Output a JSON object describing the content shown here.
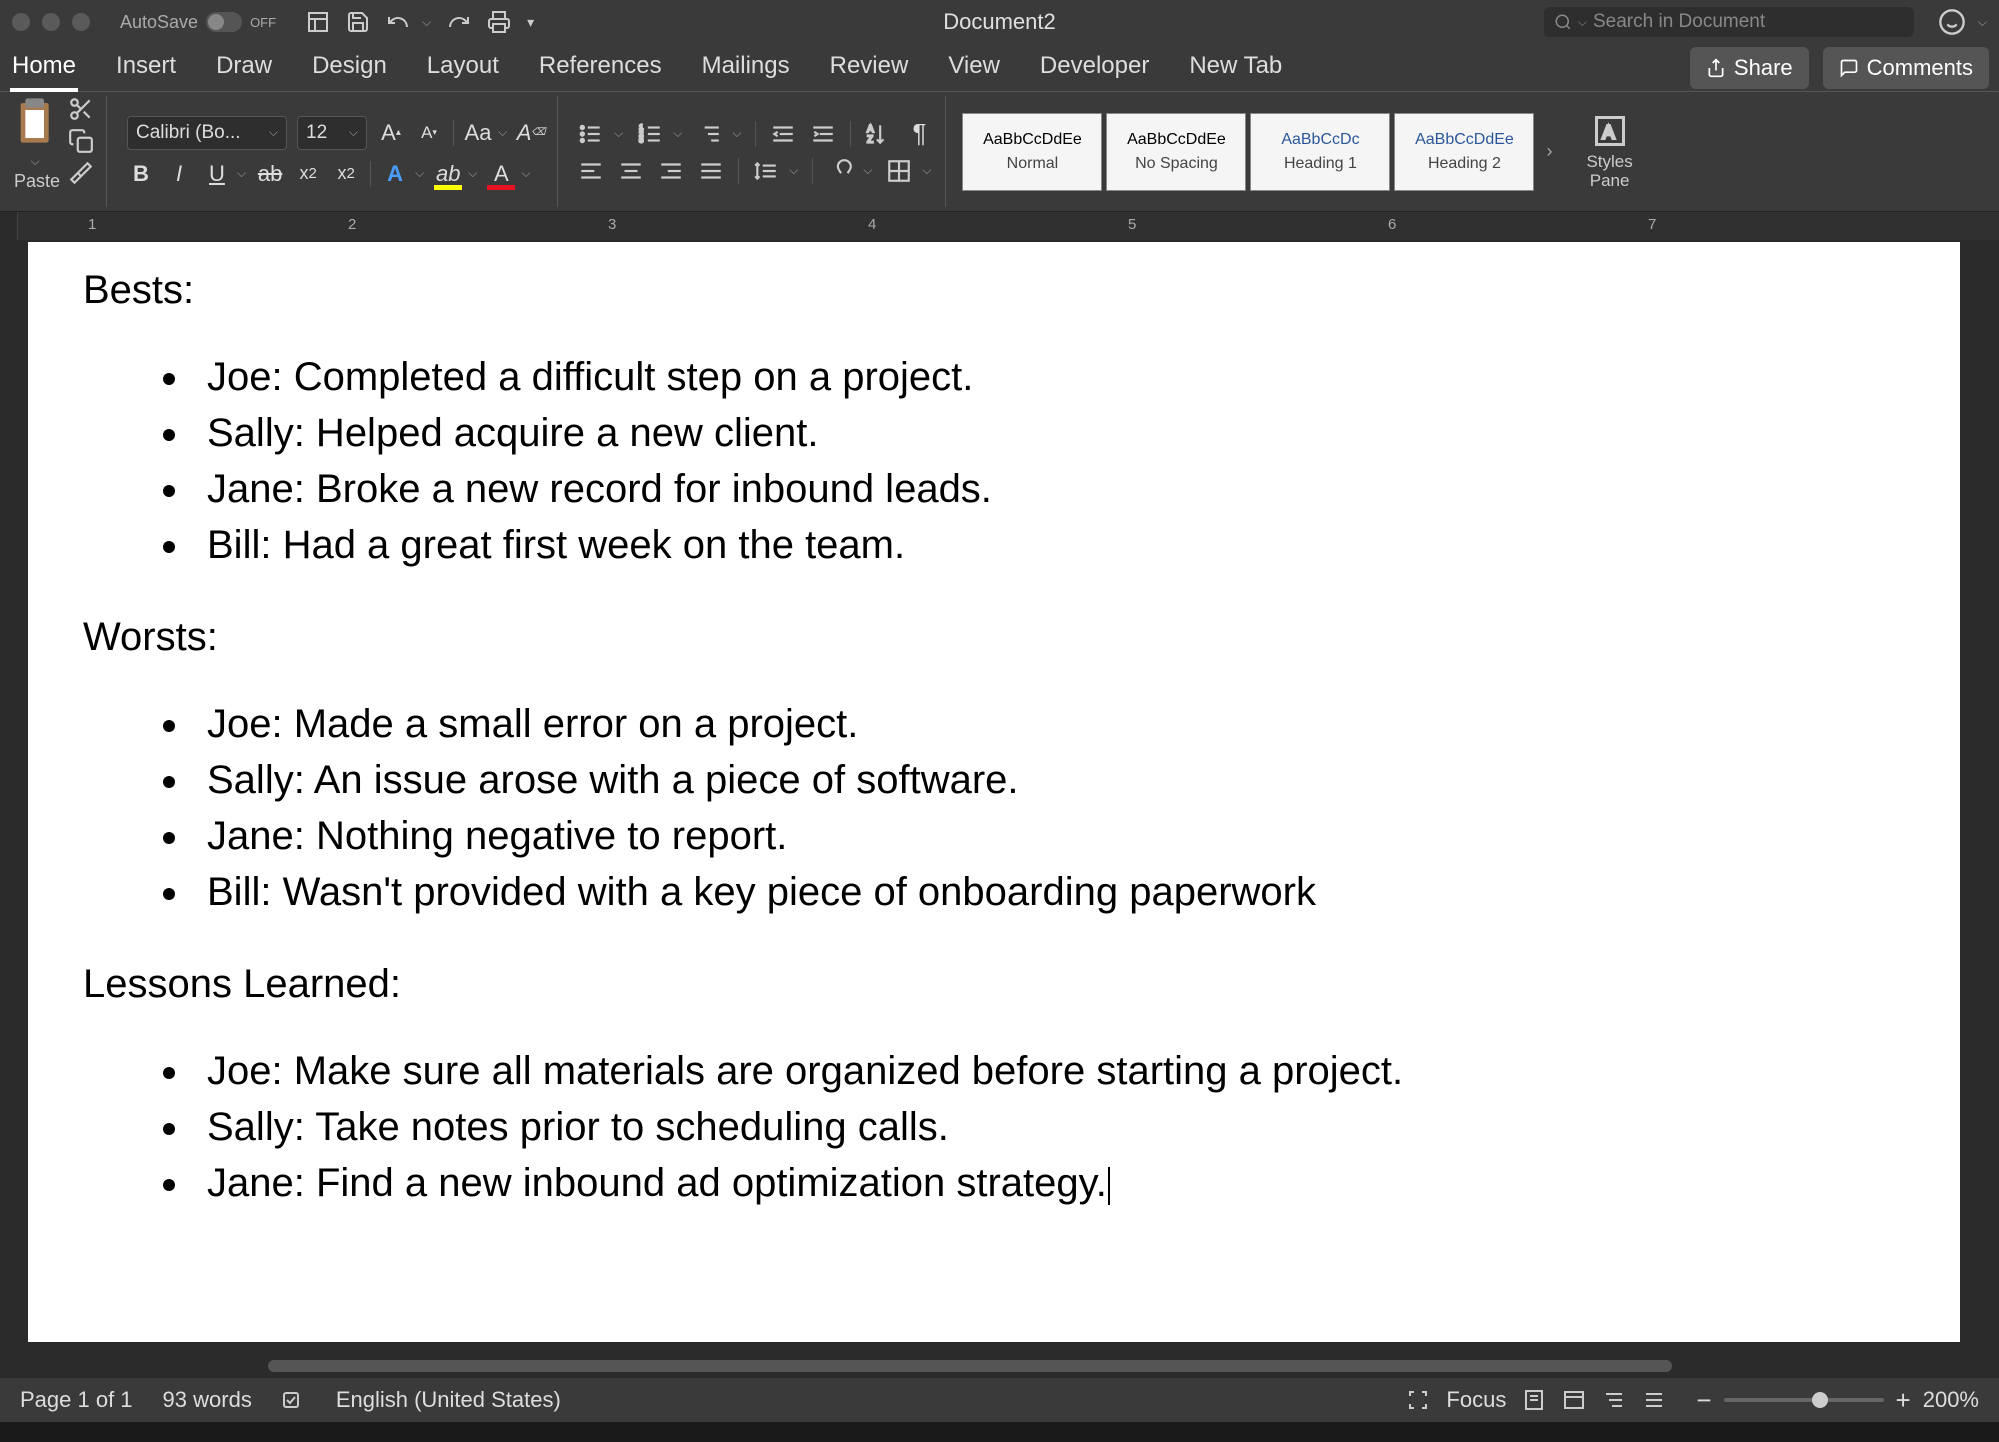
{
  "titlebar": {
    "autosave_label": "AutoSave",
    "autosave_state": "OFF",
    "doc_title": "Document2",
    "search_placeholder": "Search in Document"
  },
  "tabs": {
    "items": [
      "Home",
      "Insert",
      "Draw",
      "Design",
      "Layout",
      "References",
      "Mailings",
      "Review",
      "View",
      "Developer",
      "New Tab"
    ],
    "active_index": 0,
    "share": "Share",
    "comments": "Comments"
  },
  "ribbon": {
    "paste": "Paste",
    "font_name": "Calibri (Bo...",
    "font_size": "12",
    "styles": [
      {
        "preview": "AaBbCcDdEe",
        "name": "Normal",
        "heading": false
      },
      {
        "preview": "AaBbCcDdEe",
        "name": "No Spacing",
        "heading": false
      },
      {
        "preview": "AaBbCcDc",
        "name": "Heading 1",
        "heading": true
      },
      {
        "preview": "AaBbCcDdEe",
        "name": "Heading 2",
        "heading": true
      }
    ],
    "styles_pane": "Styles\nPane"
  },
  "ruler_numbers": [
    "1",
    "2",
    "3",
    "4",
    "5",
    "6",
    "7"
  ],
  "document": {
    "sections": [
      {
        "heading": "Bests:",
        "items": [
          "Joe: Completed a difficult step on a project.",
          "Sally: Helped acquire a new client.",
          "Jane: Broke a new record for inbound leads.",
          "Bill: Had a great first week on the team."
        ]
      },
      {
        "heading": "Worsts:",
        "items": [
          "Joe: Made a small error on a project.",
          "Sally: An issue arose with a piece of software.",
          "Jane: Nothing negative to report.",
          "Bill: Wasn't provided with a key piece of onboarding paperwork"
        ]
      },
      {
        "heading": "Lessons Learned:",
        "items": [
          "Joe: Make sure all materials are organized before starting a project.",
          "Sally: Take notes prior to scheduling calls.",
          "Jane: Find a new inbound ad optimization strategy."
        ]
      }
    ]
  },
  "statusbar": {
    "page": "Page 1 of 1",
    "words": "93 words",
    "language": "English (United States)",
    "focus": "Focus",
    "zoom": "200%"
  }
}
